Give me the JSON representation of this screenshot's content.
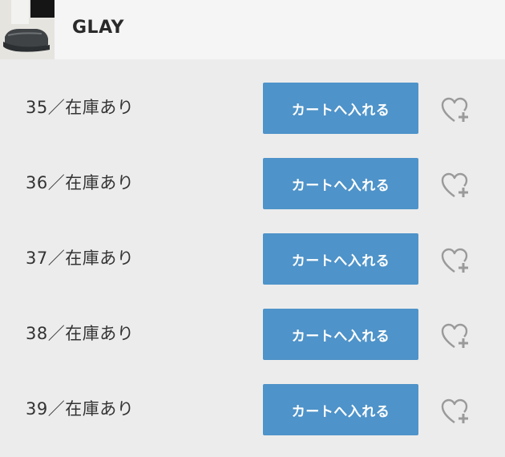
{
  "product": {
    "color_name": "GLAY",
    "thumbnail_icon": "shoe-photo"
  },
  "sizes": [
    {
      "label": "35／在庫あり",
      "cart_label": "カートへ入れる",
      "fav_icon": "heart-plus-icon"
    },
    {
      "label": "36／在庫あり",
      "cart_label": "カートへ入れる",
      "fav_icon": "heart-plus-icon"
    },
    {
      "label": "37／在庫あり",
      "cart_label": "カートへ入れる",
      "fav_icon": "heart-plus-icon"
    },
    {
      "label": "38／在庫あり",
      "cart_label": "カートへ入れる",
      "fav_icon": "heart-plus-icon"
    },
    {
      "label": "39／在庫あり",
      "cart_label": "カートへ入れる",
      "fav_icon": "heart-plus-icon"
    }
  ],
  "colors": {
    "button": "#4e93c9",
    "row_background": "#ececec",
    "header_background": "#f5f5f5",
    "icon": "#9a9a9a"
  }
}
